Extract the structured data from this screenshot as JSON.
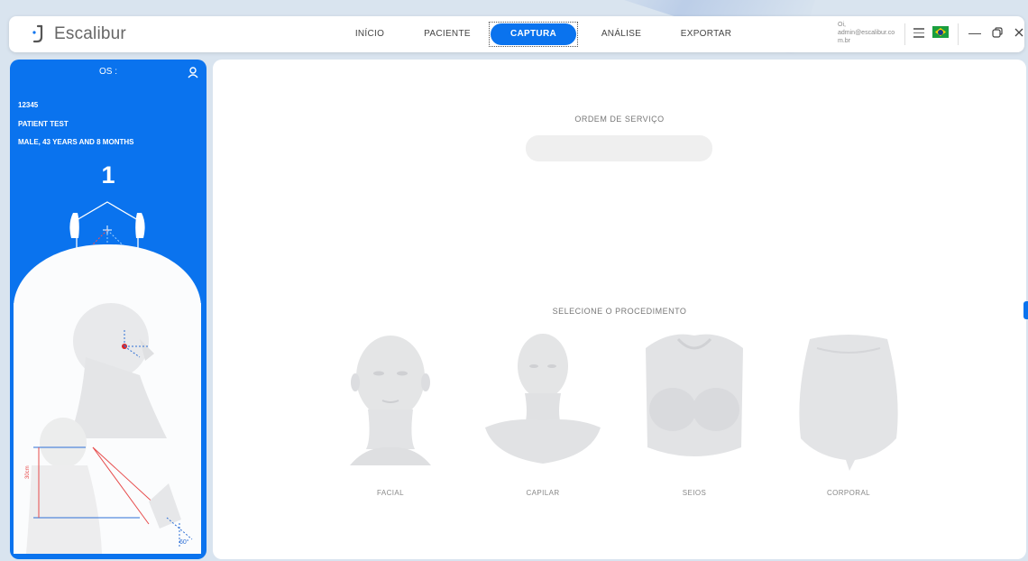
{
  "app": {
    "name": "Escalibur"
  },
  "nav": {
    "items": [
      {
        "label": "INÍCIO"
      },
      {
        "label": "PACIENTE"
      },
      {
        "label": "CAPTURA"
      },
      {
        "label": "ANÁLISE"
      },
      {
        "label": "EXPORTAR"
      }
    ],
    "active": "CAPTURA"
  },
  "user": {
    "name": "Oi,",
    "email": "admin@escalibur.com.br"
  },
  "patient_panel": {
    "os_label": "OS :",
    "id": "12345",
    "name": "PATIENT TEST",
    "details": "MALE, 43 YEARS AND  8 MONTHS",
    "step": "1",
    "distance_label": "30cm",
    "angle_label": "60°"
  },
  "main": {
    "order_label": "ORDEM DE SERVIÇO",
    "order_value": "",
    "procedure_label": "SELECIONE O PROCEDIMENTO",
    "procedures": [
      {
        "label": "FACIAL"
      },
      {
        "label": "CAPILAR"
      },
      {
        "label": "SEIOS"
      },
      {
        "label": "CORPORAL"
      }
    ]
  },
  "colors": {
    "accent": "#0a73ee",
    "panel_bg": "#ffffff",
    "page_bg": "#d9e4ef"
  },
  "icons": {
    "user": "user-icon",
    "menu": "hamburger-icon",
    "flag": "brazil-flag-icon",
    "minimize": "minimize-icon",
    "restore": "restore-icon",
    "close": "close-icon"
  }
}
